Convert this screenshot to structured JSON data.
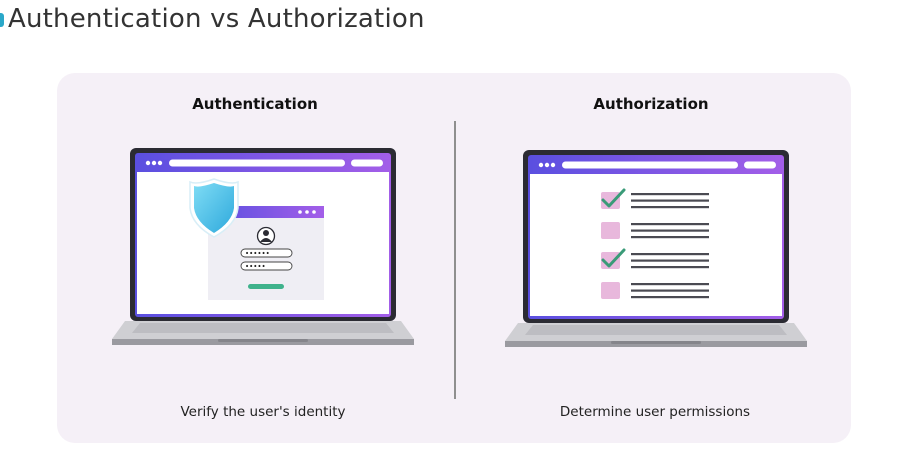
{
  "page": {
    "title": "Authentication vs Authorization"
  },
  "authentication": {
    "heading": "Authentication",
    "caption": "Verify the user's identity",
    "password_dots_1": "••••••",
    "password_dots_2": "•••••"
  },
  "authorization": {
    "heading": "Authorization",
    "caption": "Determine user permissions",
    "permissions": [
      {
        "checked": true
      },
      {
        "checked": false
      },
      {
        "checked": true
      },
      {
        "checked": false
      }
    ]
  },
  "colors": {
    "accent_gradient_start": "#5a4fe0",
    "accent_gradient_end": "#a35ee8",
    "shield": "#3fc0e8",
    "login_button": "#3fb28c",
    "checkbox": "#e8b8dc",
    "checkmark": "#3a9b78",
    "card_bg": "#f5f0f7"
  }
}
